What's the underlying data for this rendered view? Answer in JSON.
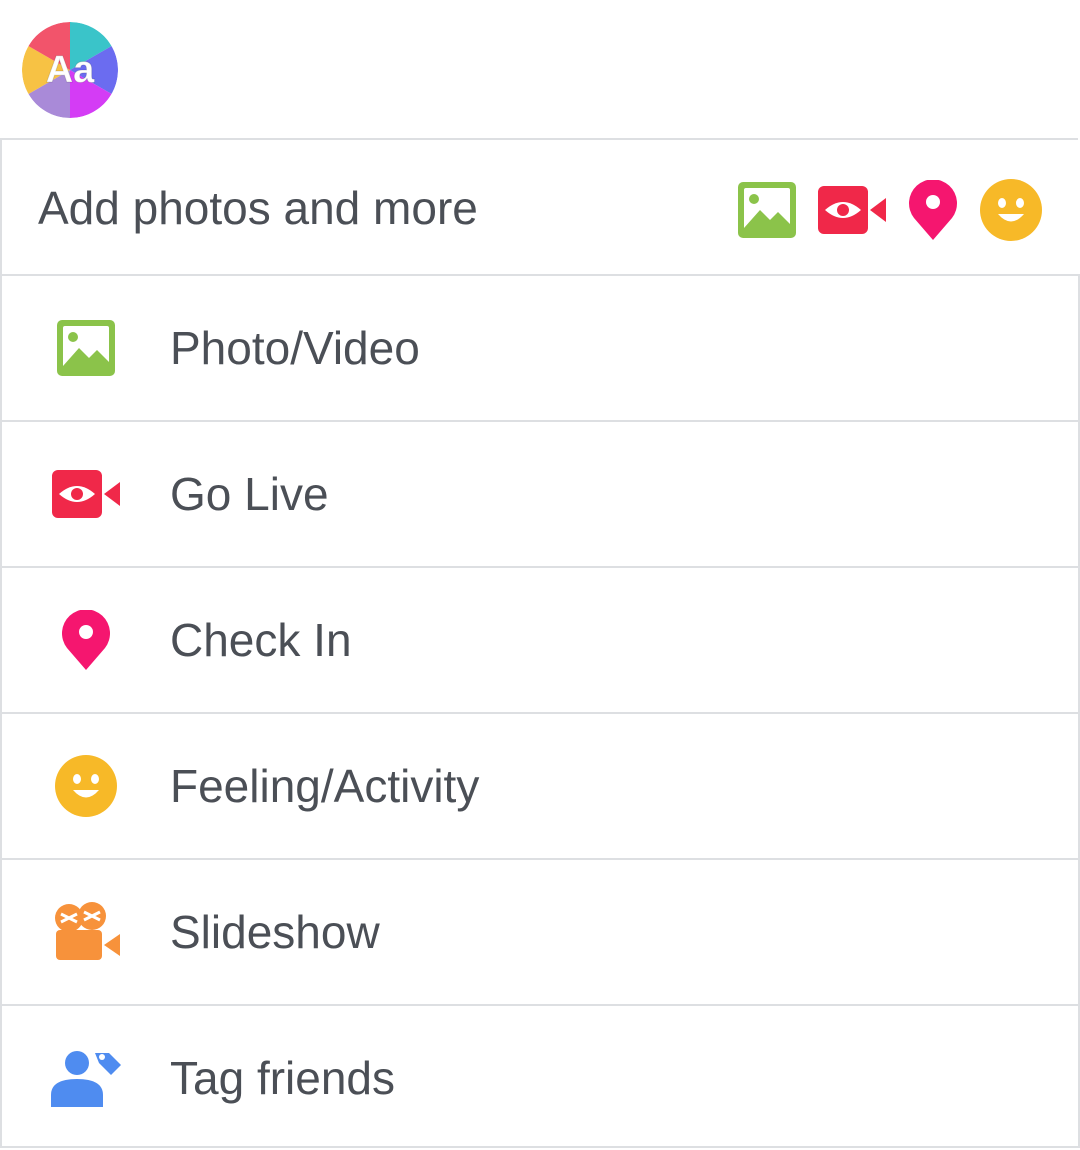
{
  "composer": {
    "text_style_button": "Aa",
    "add_bar": {
      "label": "Add photos and more",
      "icons": [
        "photo-icon",
        "live-video-icon",
        "location-pin-icon",
        "smiley-icon"
      ]
    }
  },
  "menu": {
    "items": [
      {
        "label": "Photo/Video",
        "icon": "photo-icon",
        "color": "#8bc34a"
      },
      {
        "label": "Go Live",
        "icon": "live-video-icon",
        "color": "#f02849"
      },
      {
        "label": "Check In",
        "icon": "location-pin-icon",
        "color": "#f5166f"
      },
      {
        "label": "Feeling/Activity",
        "icon": "smiley-icon",
        "color": "#f7b928"
      },
      {
        "label": "Slideshow",
        "icon": "slideshow-camera-icon",
        "color": "#f7923b"
      },
      {
        "label": "Tag friends",
        "icon": "tag-friends-icon",
        "color": "#4f8cf0"
      }
    ]
  },
  "colors": {
    "text": "#4b4f56",
    "divider": "#dddfe2"
  }
}
